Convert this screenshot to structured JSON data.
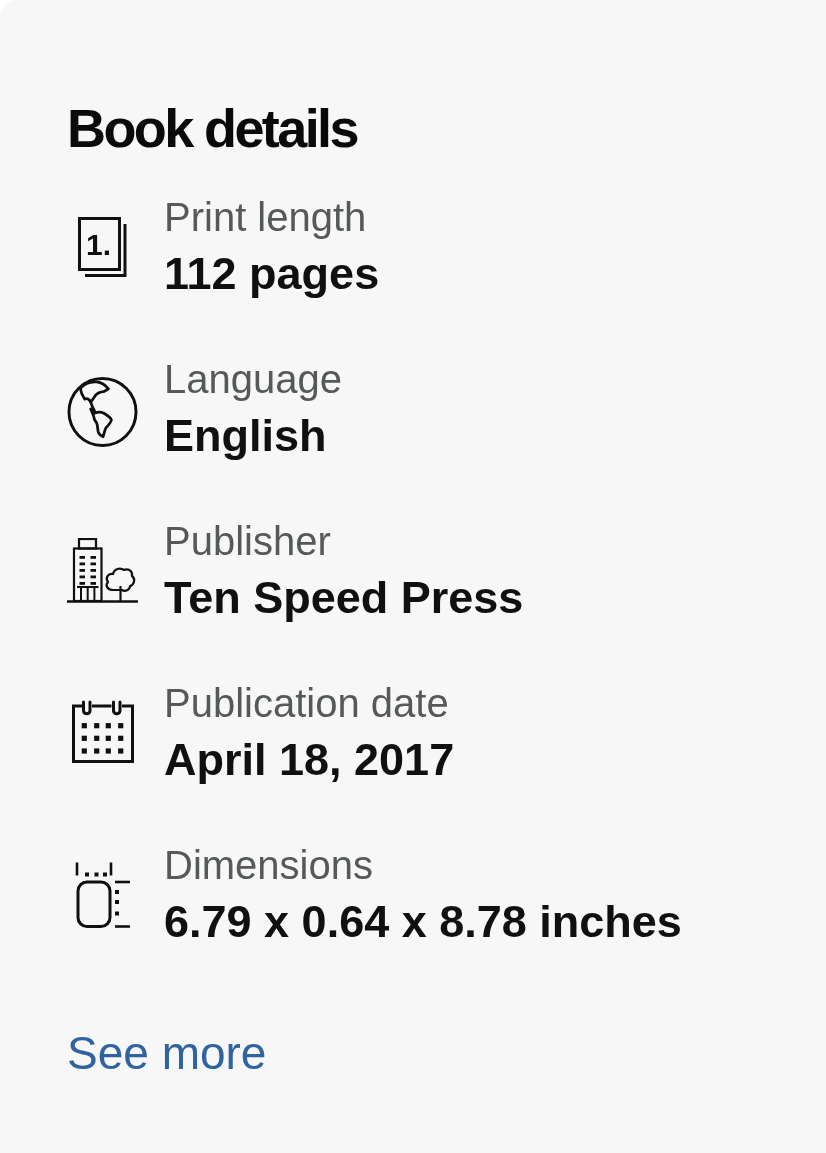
{
  "title": "Book details",
  "details": [
    {
      "kind": "pages",
      "glyph": "1.",
      "label": "Print length",
      "value": "112 pages"
    },
    {
      "kind": "globe",
      "label": "Language",
      "value": "English"
    },
    {
      "kind": "building",
      "label": "Publisher",
      "value": "Ten Speed Press"
    },
    {
      "kind": "calendar",
      "label": "Publication date",
      "value": "April 18, 2017"
    },
    {
      "kind": "dimensions",
      "label": "Dimensions",
      "value": "6.79 x 0.64 x 8.78 inches"
    }
  ],
  "see_more": "See more"
}
